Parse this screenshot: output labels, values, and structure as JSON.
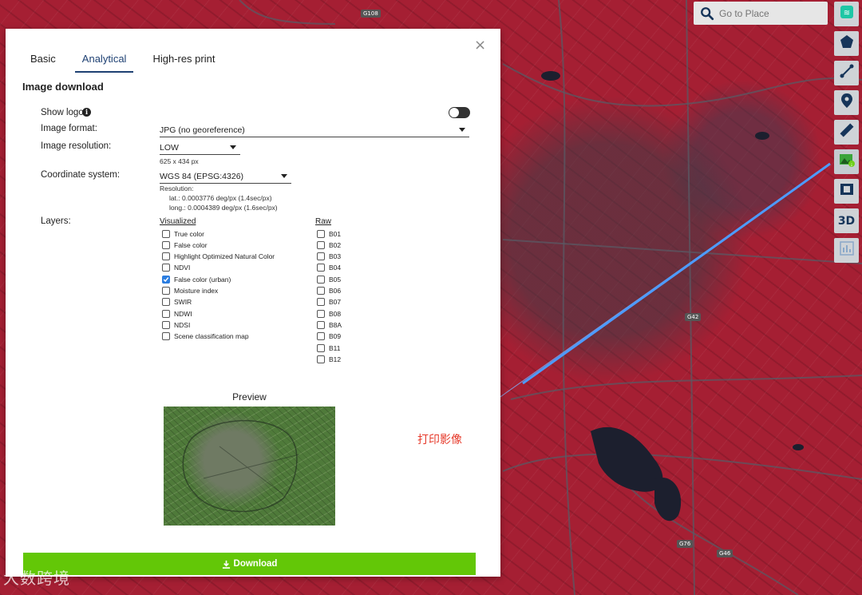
{
  "search": {
    "placeholder": "Go to Place"
  },
  "toolbar": {
    "items": [
      {
        "name": "layers-icon"
      },
      {
        "name": "pentagon-icon"
      },
      {
        "name": "measure-line-icon"
      },
      {
        "name": "location-pin-icon"
      },
      {
        "name": "ruler-icon"
      },
      {
        "name": "image-download-icon"
      },
      {
        "name": "film-icon"
      },
      {
        "name": "3d",
        "label": "3D"
      },
      {
        "name": "chart-icon"
      }
    ]
  },
  "map": {
    "road_labels": [
      "G108",
      "G42",
      "G76",
      "G46"
    ]
  },
  "dialog": {
    "tabs": [
      "Basic",
      "Analytical",
      "High-res print"
    ],
    "active_tab": "Analytical",
    "section_title": "Image download",
    "show_logo_label": "Show logo",
    "image_format_label": "Image format:",
    "image_format_value": "JPG (no georeference)",
    "image_resolution_label": "Image resolution:",
    "image_resolution_value": "LOW",
    "image_resolution_size": "625 x 434 px",
    "coord_system_label": "Coordinate system:",
    "coord_system_value": "WGS 84 (EPSG:4326)",
    "resolution_title": "Resolution:",
    "resolution_lat": "lat.: 0.0003776 deg/px (1.4sec/px)",
    "resolution_long": "long.: 0.0004389 deg/px (1.6sec/px)",
    "layers_label": "Layers:",
    "visualized_header": "Visualized",
    "raw_header": "Raw",
    "visualized": [
      {
        "label": "True color",
        "checked": false
      },
      {
        "label": "False color",
        "checked": false
      },
      {
        "label": "Highlight Optimized Natural Color",
        "checked": false
      },
      {
        "label": "NDVI",
        "checked": false
      },
      {
        "label": "False color (urban)",
        "checked": true
      },
      {
        "label": "Moisture index",
        "checked": false
      },
      {
        "label": "SWIR",
        "checked": false
      },
      {
        "label": "NDWI",
        "checked": false
      },
      {
        "label": "NDSI",
        "checked": false
      },
      {
        "label": "Scene classification map",
        "checked": false
      }
    ],
    "raw": [
      {
        "label": "B01",
        "checked": false
      },
      {
        "label": "B02",
        "checked": false
      },
      {
        "label": "B03",
        "checked": false
      },
      {
        "label": "B04",
        "checked": false
      },
      {
        "label": "B05",
        "checked": false
      },
      {
        "label": "B06",
        "checked": false
      },
      {
        "label": "B07",
        "checked": false
      },
      {
        "label": "B08",
        "checked": false
      },
      {
        "label": "B8A",
        "checked": false
      },
      {
        "label": "B09",
        "checked": false
      },
      {
        "label": "B11",
        "checked": false
      },
      {
        "label": "B12",
        "checked": false
      }
    ],
    "preview_title": "Preview",
    "download_label": "Download"
  },
  "annotation": {
    "text": "打印影像"
  },
  "watermark": {
    "text": "大数跨境"
  },
  "colors": {
    "accent": "#1f4173",
    "download": "#63c707",
    "annotation": "#e63a2b",
    "map_red": "#a51f33"
  }
}
